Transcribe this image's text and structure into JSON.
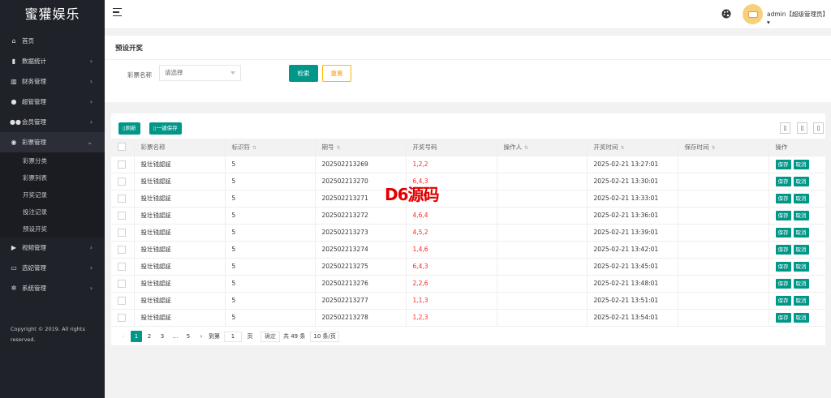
{
  "sidebar": {
    "logo": "蜜獾娱乐",
    "items": [
      {
        "label": "首页",
        "icon": "home-icon",
        "glyph": "⌂",
        "arrow": ""
      },
      {
        "label": "数据统计",
        "icon": "chart-bar-icon",
        "glyph": "▮",
        "arrow": "›"
      },
      {
        "label": "财务管理",
        "icon": "bank-icon",
        "glyph": "▥",
        "arrow": "›"
      },
      {
        "label": "超管管理",
        "icon": "user-icon",
        "glyph": "●",
        "arrow": "›"
      },
      {
        "label": "会员管理",
        "icon": "users-icon",
        "glyph": "●●",
        "arrow": "›"
      },
      {
        "label": "彩票管理",
        "icon": "gamepad-icon",
        "glyph": "◉",
        "arrow": "⌄"
      }
    ],
    "sub_items": [
      "彩票分类",
      "彩票列表",
      "开奖记录",
      "投注记录",
      "预设开奖"
    ],
    "items_after": [
      {
        "label": "视频管理",
        "icon": "video-icon",
        "glyph": "▶",
        "arrow": "›"
      },
      {
        "label": "选妃管理",
        "icon": "ticket-icon",
        "glyph": "▭",
        "arrow": "›"
      },
      {
        "label": "系统管理",
        "icon": "gear-icon",
        "glyph": "✲",
        "arrow": "›"
      }
    ],
    "copyright": "Copyright © 2019. All rights reserved."
  },
  "header": {
    "user": "admin【超级管理员】",
    "caret": "▾"
  },
  "search": {
    "title": "预设开奖",
    "label": "彩票名称",
    "placeholder": "请选择",
    "search_btn": "检索",
    "reset_btn": "重置"
  },
  "toolbar": {
    "refresh": "刷新",
    "save_all": "一键保存",
    "refresh_icon": "refresh-icon",
    "save_icon": "save-icon"
  },
  "table": {
    "headers": [
      "彩票名称",
      "标识符",
      "期号",
      "开奖号码",
      "操作人",
      "开奖时间",
      "保存时间",
      "操作"
    ],
    "sortable": [
      false,
      true,
      true,
      false,
      true,
      true,
      true,
      false
    ],
    "rows": [
      [
        "投壮钱認証",
        "5",
        "202502213269",
        "1,2,2",
        "",
        "2025-02-21 13:27:01",
        ""
      ],
      [
        "投壮钱認証",
        "5",
        "202502213270",
        "6,4,3",
        "",
        "2025-02-21 13:30:01",
        ""
      ],
      [
        "投壮钱認証",
        "5",
        "202502213271",
        "3,2,6",
        "",
        "2025-02-21 13:33:01",
        ""
      ],
      [
        "投壮钱認証",
        "5",
        "202502213272",
        "4,6,4",
        "",
        "2025-02-21 13:36:01",
        ""
      ],
      [
        "投壮钱認証",
        "5",
        "202502213273",
        "4,5,2",
        "",
        "2025-02-21 13:39:01",
        ""
      ],
      [
        "投壮钱認証",
        "5",
        "202502213274",
        "1,4,6",
        "",
        "2025-02-21 13:42:01",
        ""
      ],
      [
        "投壮钱認証",
        "5",
        "202502213275",
        "6,4,3",
        "",
        "2025-02-21 13:45:01",
        ""
      ],
      [
        "投壮钱認証",
        "5",
        "202502213276",
        "2,2,6",
        "",
        "2025-02-21 13:48:01",
        ""
      ],
      [
        "投壮钱認証",
        "5",
        "202502213277",
        "1,1,3",
        "",
        "2025-02-21 13:51:01",
        ""
      ],
      [
        "投壮钱認証",
        "5",
        "202502213278",
        "1,2,3",
        "",
        "2025-02-21 13:54:01",
        ""
      ]
    ],
    "save_btn": "保存",
    "cancel_btn": "取消"
  },
  "pager": {
    "prev": "‹",
    "pages": [
      "1",
      "2",
      "3"
    ],
    "ellipsis": "...",
    "last": "5",
    "next": "›",
    "goto_label": "到第",
    "goto_value": "1",
    "page_unit": "页",
    "confirm": "确定",
    "total": "共 49 条",
    "per_page": "10 条/页"
  },
  "watermark": "D6源码",
  "colors": {
    "primary": "#009688",
    "warning": "#ffb800",
    "sidebar": "#20222a",
    "number": "#ff2222"
  }
}
